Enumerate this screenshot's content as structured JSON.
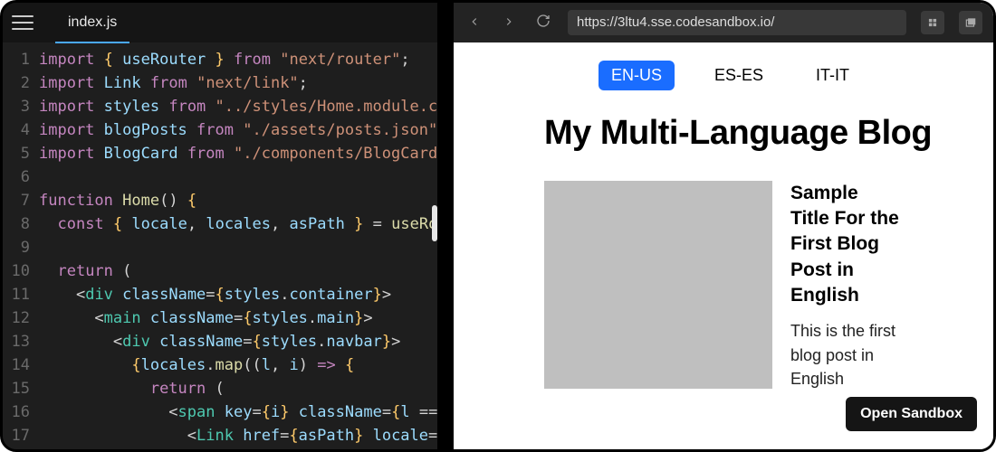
{
  "editor": {
    "tab_filename": "index.js",
    "line_numbers": [
      "1",
      "2",
      "3",
      "4",
      "5",
      "6",
      "7",
      "8",
      "9",
      "10",
      "11",
      "12",
      "13",
      "14",
      "15",
      "16",
      "17"
    ],
    "code_lines_raw": [
      "import { useRouter } from \"next/router\";",
      "import Link from \"next/link\";",
      "import styles from \"../styles/Home.module.c",
      "import blogPosts from \"./assets/posts.json\"",
      "import BlogCard from \"./components/BlogCard",
      "",
      "function Home() {",
      "  const { locale, locales, asPath } = useRo",
      "",
      "  return (",
      "    <div className={styles.container}>",
      "      <main className={styles.main}>",
      "        <div className={styles.navbar}>",
      "          {locales.map((l, i) => {",
      "            return (",
      "              <span key={i} className={l ==",
      "                <Link href={asPath} locale="
    ]
  },
  "browser": {
    "url": "https://3ltu4.sse.codesandbox.io/"
  },
  "page": {
    "languages": [
      {
        "code": "EN-US",
        "active": true
      },
      {
        "code": "ES-ES",
        "active": false
      },
      {
        "code": "IT-IT",
        "active": false
      }
    ],
    "title": "My Multi-Language Blog",
    "post": {
      "title": "Sample Title For the First Blog Post in English",
      "excerpt": "This is the first blog post in English"
    },
    "open_sandbox_label": "Open Sandbox"
  }
}
